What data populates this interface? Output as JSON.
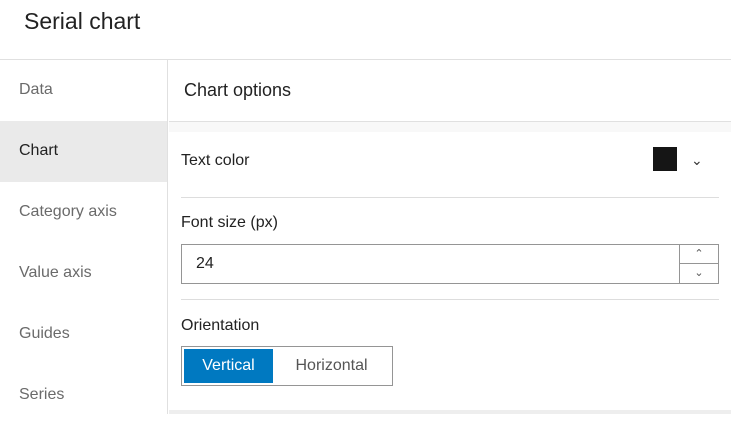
{
  "title": "Serial chart",
  "sidebar": {
    "items": [
      {
        "label": "Data"
      },
      {
        "label": "Chart"
      },
      {
        "label": "Category axis"
      },
      {
        "label": "Value axis"
      },
      {
        "label": "Guides"
      },
      {
        "label": "Series"
      }
    ],
    "active": "Chart"
  },
  "panel": {
    "heading": "Chart options",
    "text_color": {
      "label": "Text color",
      "value": "#151515"
    },
    "font_size": {
      "label": "Font size (px)",
      "value": "24"
    },
    "orientation": {
      "label": "Orientation",
      "options": [
        "Vertical",
        "Horizontal"
      ],
      "selected": "Vertical"
    }
  },
  "colors": {
    "accent": "#0079c1"
  }
}
